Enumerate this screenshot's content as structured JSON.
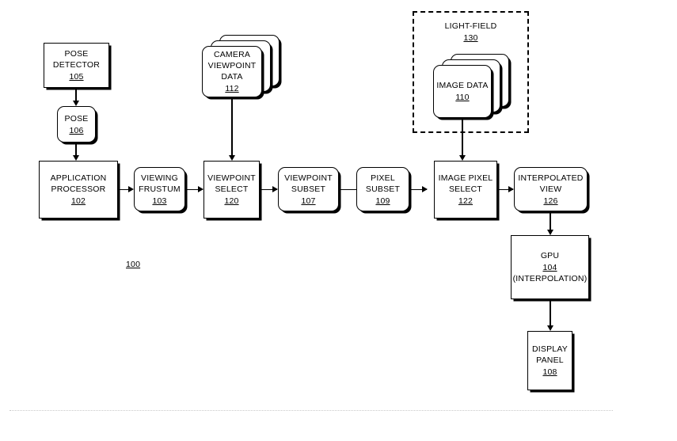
{
  "figure": {
    "label": "100"
  },
  "groups": [
    {
      "id": "light-field",
      "title": "LIGHT-FIELD",
      "ref": "130"
    }
  ],
  "nodes": {
    "pose_detector": {
      "line1": "POSE",
      "line2": "DETECTOR",
      "ref": "105"
    },
    "pose": {
      "line1": "POSE",
      "ref": "106"
    },
    "application_processor": {
      "line1": "APPLICATION",
      "line2": "PROCESSOR",
      "ref": "102"
    },
    "viewing_frustum": {
      "line1": "VIEWING",
      "line2": "FRUSTUM",
      "ref": "103"
    },
    "camera_viewpoint_data": {
      "line1": "CAMERA",
      "line2": "VIEWPOINT",
      "line3": "DATA",
      "ref": "112"
    },
    "viewpoint_select": {
      "line1": "VIEWPOINT",
      "line2": "SELECT",
      "ref": "120"
    },
    "viewpoint_subset": {
      "line1": "VIEWPOINT",
      "line2": "SUBSET",
      "ref": "107"
    },
    "pixel_subset": {
      "line1": "PIXEL",
      "line2": "SUBSET",
      "ref": "109"
    },
    "image_data": {
      "line1": "IMAGE DATA",
      "ref": "110"
    },
    "image_pixel_select": {
      "line1": "IMAGE PIXEL",
      "line2": "SELECT",
      "ref": "122"
    },
    "interpolated_view": {
      "line1": "INTERPOLATED",
      "line2": "VIEW",
      "ref": "126"
    },
    "gpu": {
      "line1": "GPU",
      "ref": "104",
      "line3": "(INTERPOLATION)"
    },
    "display_panel": {
      "line1": "DISPLAY",
      "line2": "PANEL",
      "ref": "108"
    }
  },
  "colors": {
    "stroke": "#000000",
    "background": "#ffffff",
    "footer_rule": "#c9c9c9"
  }
}
